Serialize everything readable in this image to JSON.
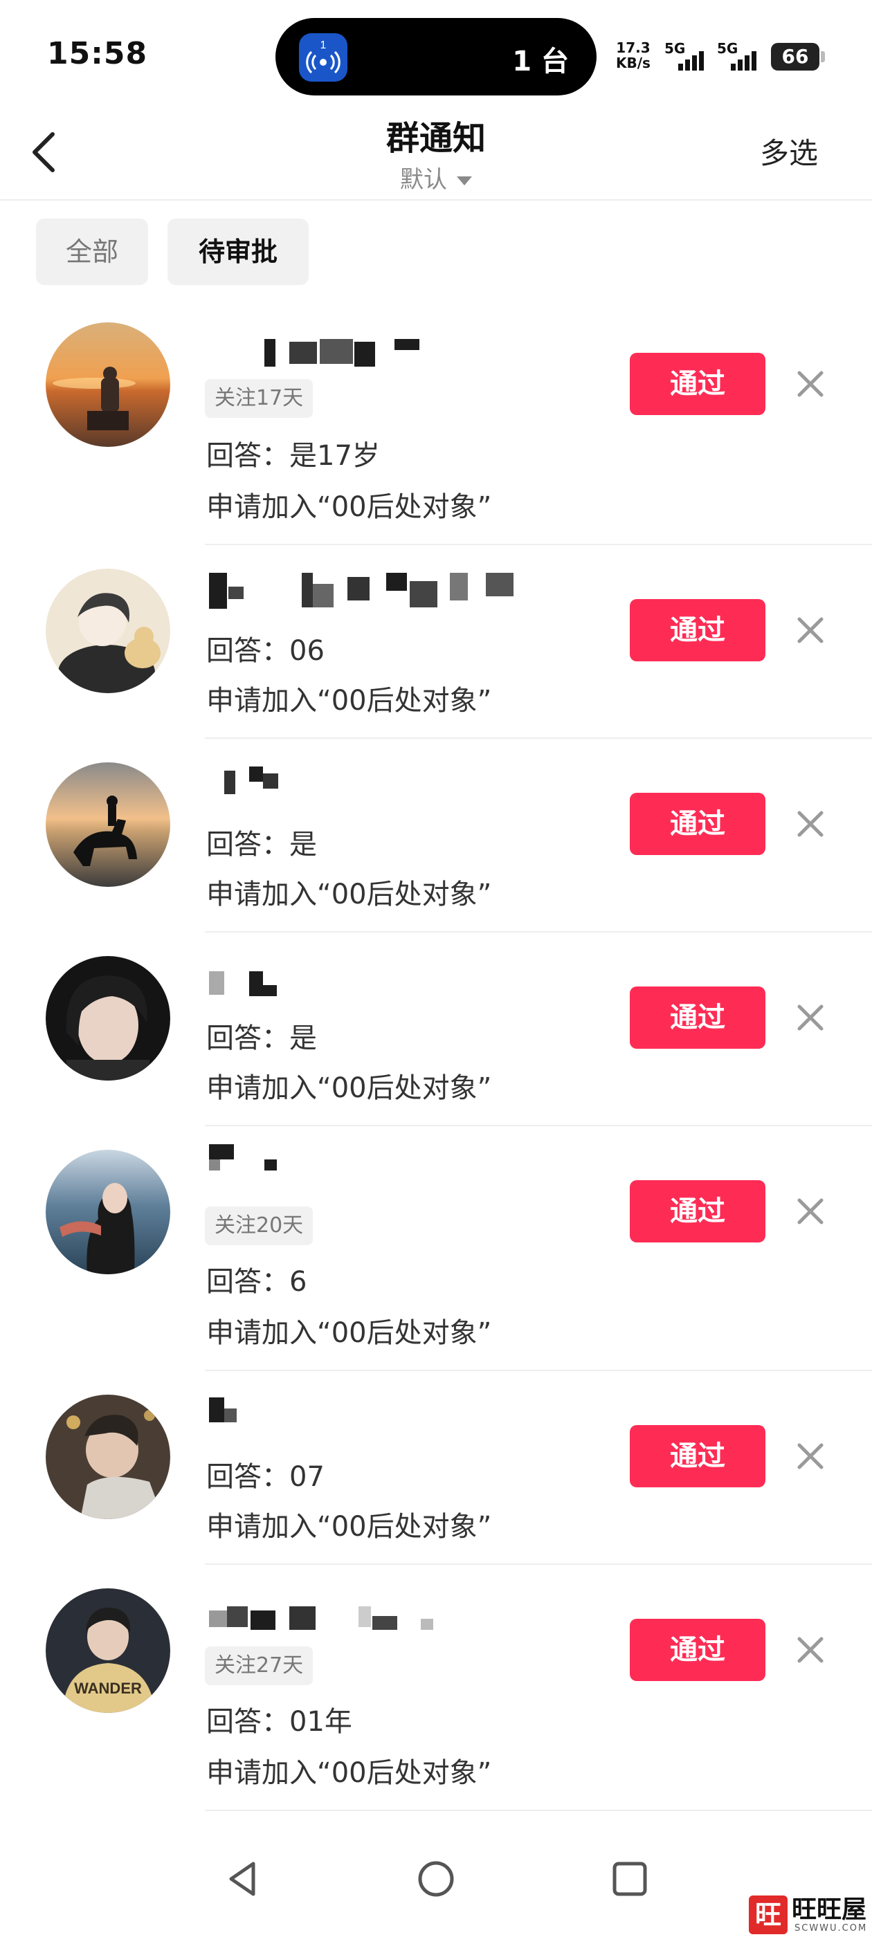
{
  "status_bar": {
    "time": "15:58",
    "island_text": "1 台",
    "island_badge": "1",
    "net_speed_value": "17.3",
    "net_speed_unit": "KB/s",
    "signal_1": "5G",
    "signal_2": "5G",
    "battery": "66"
  },
  "header": {
    "title": "群通知",
    "sort_label": "默认",
    "multi_select": "多选"
  },
  "filters": {
    "all": "全部",
    "pending": "待审批"
  },
  "requests": [
    {
      "follow": "关注17天",
      "answer": "回答：是17岁",
      "apply": "申请加入“00后处对象”",
      "approve": "通过"
    },
    {
      "follow": "",
      "answer": "回答：06",
      "apply": "申请加入“00后处对象”",
      "approve": "通过"
    },
    {
      "follow": "",
      "answer": "回答：是",
      "apply": "申请加入“00后处对象”",
      "approve": "通过"
    },
    {
      "follow": "",
      "answer": "回答：是",
      "apply": "申请加入“00后处对象”",
      "approve": "通过"
    },
    {
      "follow": "关注20天",
      "answer": "回答：6",
      "apply": "申请加入“00后处对象”",
      "approve": "通过"
    },
    {
      "follow": "",
      "answer": "回答：07",
      "apply": "申请加入“00后处对象”",
      "approve": "通过"
    },
    {
      "follow": "关注27天",
      "answer": "回答：01年",
      "apply": "申请加入“00后处对象”",
      "approve": "通过"
    }
  ],
  "watermark": {
    "logo": "旺",
    "brand": "旺旺屋",
    "domain": "SCWWU.COM"
  },
  "colors": {
    "accent": "#fe2c55",
    "chip_bg": "#f1f1f1",
    "text_secondary": "#8a8a8a"
  },
  "icons": [
    "back-arrow-icon",
    "caret-down-icon",
    "close-icon",
    "nav-back-icon",
    "nav-home-icon",
    "nav-recents-icon",
    "broadcast-icon"
  ]
}
